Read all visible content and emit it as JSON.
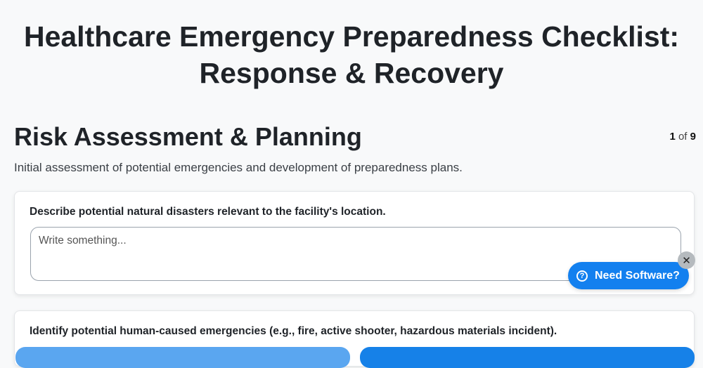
{
  "document": {
    "title": "Healthcare Emergency Preparedness Checklist: Response & Recovery"
  },
  "section": {
    "title": "Risk Assessment & Planning",
    "description": "Initial assessment of potential emergencies and development of preparedness plans.",
    "page_current": "1",
    "page_of": "of",
    "page_total": "9"
  },
  "questions": [
    {
      "label": "Describe potential natural disasters relevant to the facility's location.",
      "placeholder": "Write something...",
      "value": ""
    },
    {
      "label": "Identify potential human-caused emergencies (e.g., fire, active shooter, hazardous materials incident)."
    }
  ],
  "widget": {
    "need_software_label": "Need Software?",
    "help_icon_glyph": "?",
    "close_glyph": "✕",
    "brand_color": "#1380ef"
  }
}
